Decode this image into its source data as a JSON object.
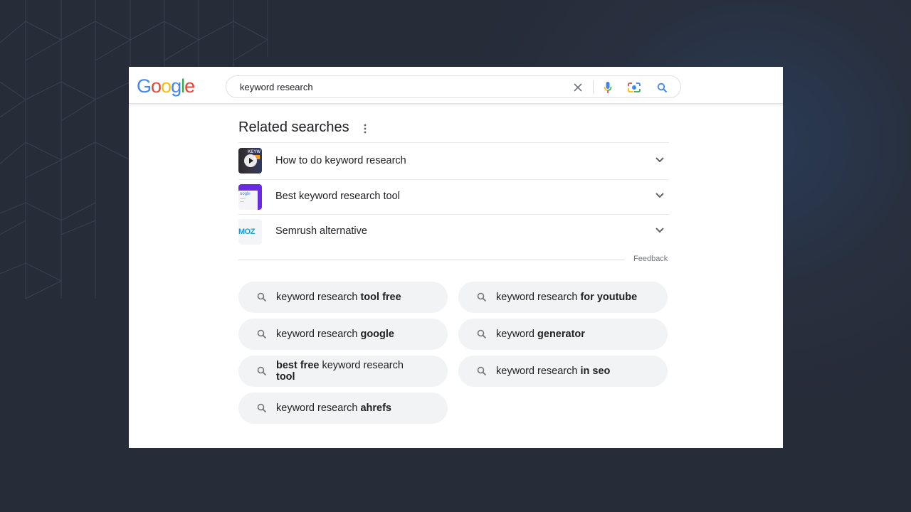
{
  "header": {
    "logo_text": "Google",
    "search_value": "keyword research",
    "icons": [
      "clear-icon",
      "microphone-icon",
      "lens-camera-icon",
      "search-icon"
    ]
  },
  "related": {
    "title": "Related searches",
    "menu_icon": "more-vert-icon",
    "items": [
      {
        "label": "How to do keyword research",
        "thumb": "video-thumbnail",
        "icon": "chevron-down-icon"
      },
      {
        "label": "Best keyword research tool",
        "thumb": "article-thumbnail",
        "icon": "chevron-down-icon"
      },
      {
        "label": "Semrush alternative",
        "thumb": "moz-logo-thumbnail",
        "thumb_text": "MOZ",
        "icon": "chevron-down-icon"
      }
    ],
    "feedback": "Feedback"
  },
  "chips": [
    {
      "normal": "keyword research ",
      "bold": "tool free"
    },
    {
      "normal": "keyword research ",
      "bold": "for youtube"
    },
    {
      "normal": "keyword research ",
      "bold": "google"
    },
    {
      "normal": "keyword ",
      "bold": "generator"
    },
    {
      "bold_pre": "best free",
      "normal": " keyword research ",
      "bold": "tool"
    },
    {
      "normal": "keyword research ",
      "bold": "in seo"
    },
    {
      "normal": "keyword research ",
      "bold": "ahrefs"
    }
  ],
  "colors": {
    "google_blue": "#4285f4",
    "google_red": "#ea4335",
    "google_yellow": "#fbbc05",
    "google_green": "#34a853",
    "chip_bg": "#f1f3f4",
    "page_bg": "#272d39"
  }
}
